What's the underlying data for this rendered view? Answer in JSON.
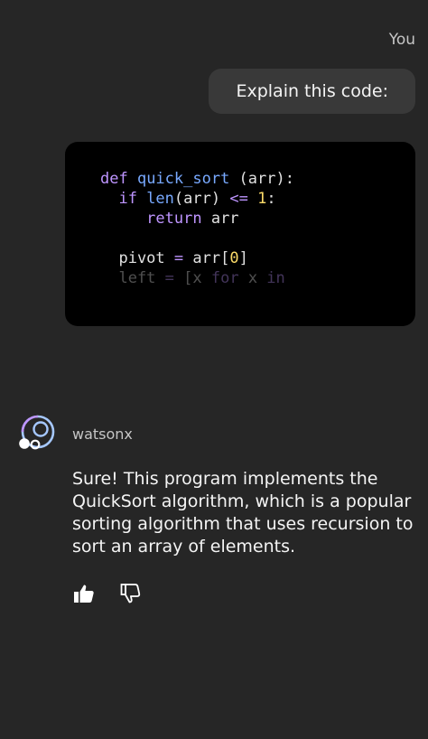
{
  "conversation": {
    "user_label": "You",
    "user_message": "Explain this code:",
    "code_lines": [
      {
        "parts": [
          {
            "t": "def ",
            "c": "kw"
          },
          {
            "t": "quick_sort",
            "c": "fn"
          },
          {
            "t": " (arr):",
            "c": "txt"
          }
        ]
      },
      {
        "parts": [
          {
            "t": "  if ",
            "c": "kw"
          },
          {
            "t": "len",
            "c": "fn"
          },
          {
            "t": "(arr) ",
            "c": "txt"
          },
          {
            "t": "<=",
            "c": "op"
          },
          {
            "t": " ",
            "c": "txt"
          },
          {
            "t": "1",
            "c": "num"
          },
          {
            "t": ":",
            "c": "txt"
          }
        ]
      },
      {
        "parts": [
          {
            "t": "     return ",
            "c": "kw"
          },
          {
            "t": "arr",
            "c": "txt"
          }
        ]
      },
      {
        "parts": []
      },
      {
        "parts": [
          {
            "t": "  pivot ",
            "c": "txt"
          },
          {
            "t": "=",
            "c": "op"
          },
          {
            "t": " arr[",
            "c": "txt"
          },
          {
            "t": "0",
            "c": "num"
          },
          {
            "t": "]",
            "c": "txt"
          }
        ]
      },
      {
        "parts": [
          {
            "t": "  left ",
            "c": "txt"
          },
          {
            "t": "=",
            "c": "op"
          },
          {
            "t": " [x ",
            "c": "txt"
          },
          {
            "t": "for",
            "c": "kw"
          },
          {
            "t": " x ",
            "c": "txt"
          },
          {
            "t": "in",
            "c": "kw"
          }
        ],
        "faded": true
      }
    ],
    "assistant_name": "watsonx",
    "assistant_message": "Sure! This program implements the QuickSort algorithm, which is a popular sorting algorithm that uses recursion to sort an array of elements."
  },
  "feedback": {
    "like_icon": "thumbs-up-icon",
    "dislike_icon": "thumbs-down-icon"
  },
  "colors": {
    "background": "#262626",
    "bubble": "#393939",
    "code_bg": "#000000",
    "keyword": "#be95ff",
    "function": "#78a9ff",
    "number": "#fddc69"
  }
}
